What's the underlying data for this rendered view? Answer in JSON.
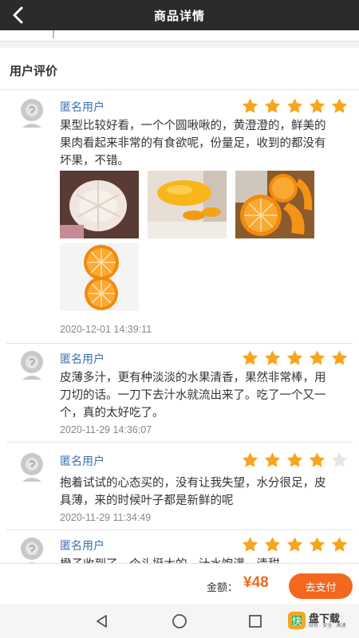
{
  "header": {
    "title": "商品详情"
  },
  "section": {
    "title": "用户评价"
  },
  "reviews": [
    {
      "user": "匿名用户",
      "rating": 5,
      "text": "果型比较好看，一个个圆啾啾的，黄澄澄的，鲜美的果肉看起来非常的有食欲呢，份量足，收到的都没有坏果，不错。",
      "time": "2020-12-01 14:39:11",
      "photos": [
        "peeled-orange-photo",
        "yellow-oranges-photo",
        "cut-orange-slices-photo",
        "orange-halves-photo"
      ]
    },
    {
      "user": "匿名用户",
      "rating": 5,
      "text": "皮薄多汁，更有种淡淡的水果清香，果然非常棒，用刀切的话。一刀下去汁水就流出来了。吃了一个又一个，真的太好吃了。",
      "time": "2020-11-29 14:36:07"
    },
    {
      "user": "匿名用户",
      "rating": 4,
      "text": "抱着试试的心态买的，没有让我失望，水分很足，皮具薄，来的时候叶子都是新鲜的呢",
      "time": "2020-11-29 11:34:49"
    },
    {
      "user": "匿名用户",
      "rating": 5,
      "text": "橙子收到了，个头挺大的，汁水饱满，清甜"
    }
  ],
  "footer": {
    "amount_label": "金额：",
    "amount": "¥48",
    "pay_label": "去支付"
  },
  "watermark": {
    "logo": "快",
    "big": "盘下载",
    "small": "绿色 · 安全 · 高速"
  },
  "colors": {
    "accent": "#f3681e",
    "star": "#f7a51c",
    "name": "#3a6fb0"
  }
}
